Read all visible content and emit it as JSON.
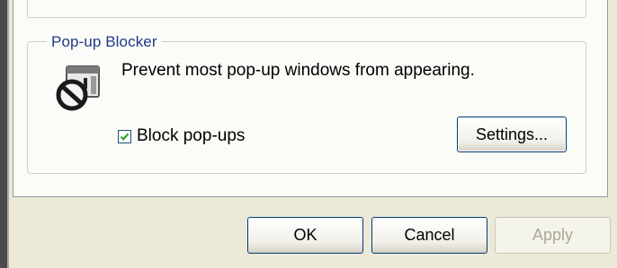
{
  "popup_blocker": {
    "group_title": "Pop-up Blocker",
    "description": "Prevent most pop-up windows from appearing.",
    "block_popups_label": "Block pop-ups",
    "block_popups_checked": true,
    "settings_label": "Settings...",
    "icon": "popup-blocker-icon"
  },
  "footer": {
    "ok_label": "OK",
    "cancel_label": "Cancel",
    "apply_label": "Apply",
    "apply_enabled": false
  },
  "colors": {
    "group_title": "#1f3a8a",
    "dialog_background": "#ece9d8",
    "tab_page_background": "#fbfbf8"
  }
}
